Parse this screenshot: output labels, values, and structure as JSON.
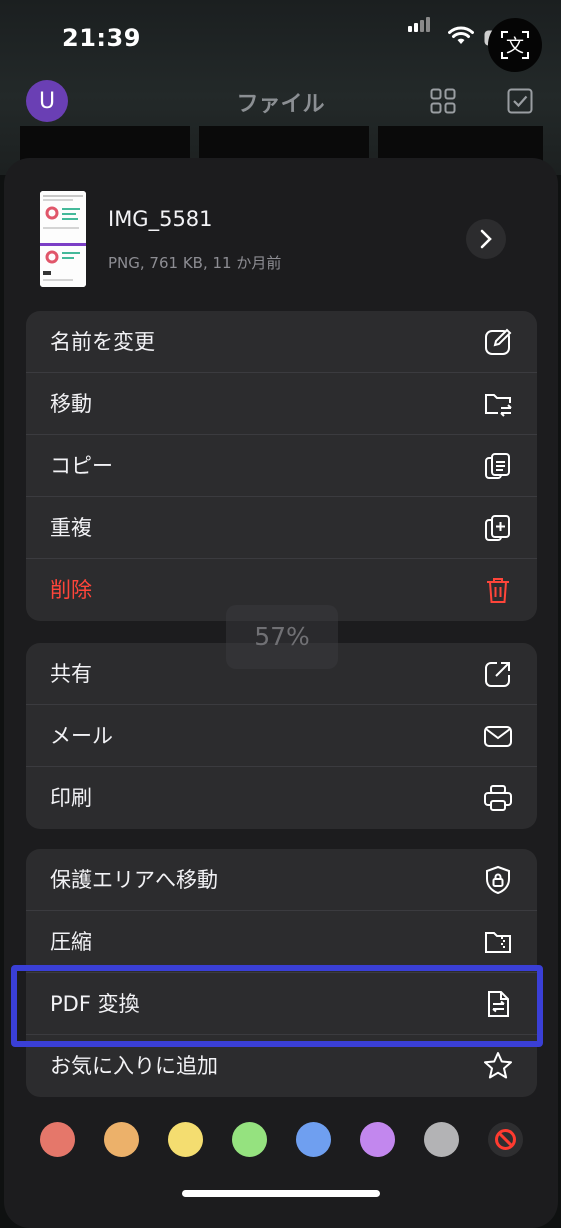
{
  "status_bar": {
    "time": "21:39"
  },
  "nav": {
    "avatar_letter": "U",
    "title": "ファイル",
    "grid_icon": "grid-icon",
    "select_icon": "checkbox-icon",
    "translate_icon": "translate-icon",
    "translate_char": "文"
  },
  "file": {
    "name": "IMG_5581",
    "meta": "PNG, 761 KB, 11 か月前"
  },
  "groups": [
    {
      "items": [
        {
          "label": "名前を変更",
          "icon": "edit-icon"
        },
        {
          "label": "移動",
          "icon": "move-folder-icon"
        },
        {
          "label": "コピー",
          "icon": "copy-icon"
        },
        {
          "label": "重複",
          "icon": "duplicate-icon"
        },
        {
          "label": "削除",
          "icon": "trash-icon",
          "danger": true
        }
      ]
    },
    {
      "items": [
        {
          "label": "共有",
          "icon": "share-icon"
        },
        {
          "label": "メール",
          "icon": "mail-icon"
        },
        {
          "label": "印刷",
          "icon": "printer-icon"
        }
      ]
    },
    {
      "items": [
        {
          "label": "保護エリアへ移動",
          "icon": "shield-lock-icon"
        },
        {
          "label": "圧縮",
          "icon": "zip-folder-icon"
        },
        {
          "label": "PDF 変換",
          "icon": "pdf-convert-icon"
        },
        {
          "label": "お気に入りに追加",
          "icon": "star-icon"
        }
      ]
    }
  ],
  "progress": {
    "text": "57%"
  },
  "colors": {
    "accent_highlight": "#3a3fd6",
    "danger": "#ff453a",
    "tags": [
      "#e5776a",
      "#ecb16a",
      "#f4dd70",
      "#95e27f",
      "#6f9ff0",
      "#c287ee",
      "#b3b3b5"
    ],
    "no_tag_icon": "no-color-icon"
  }
}
